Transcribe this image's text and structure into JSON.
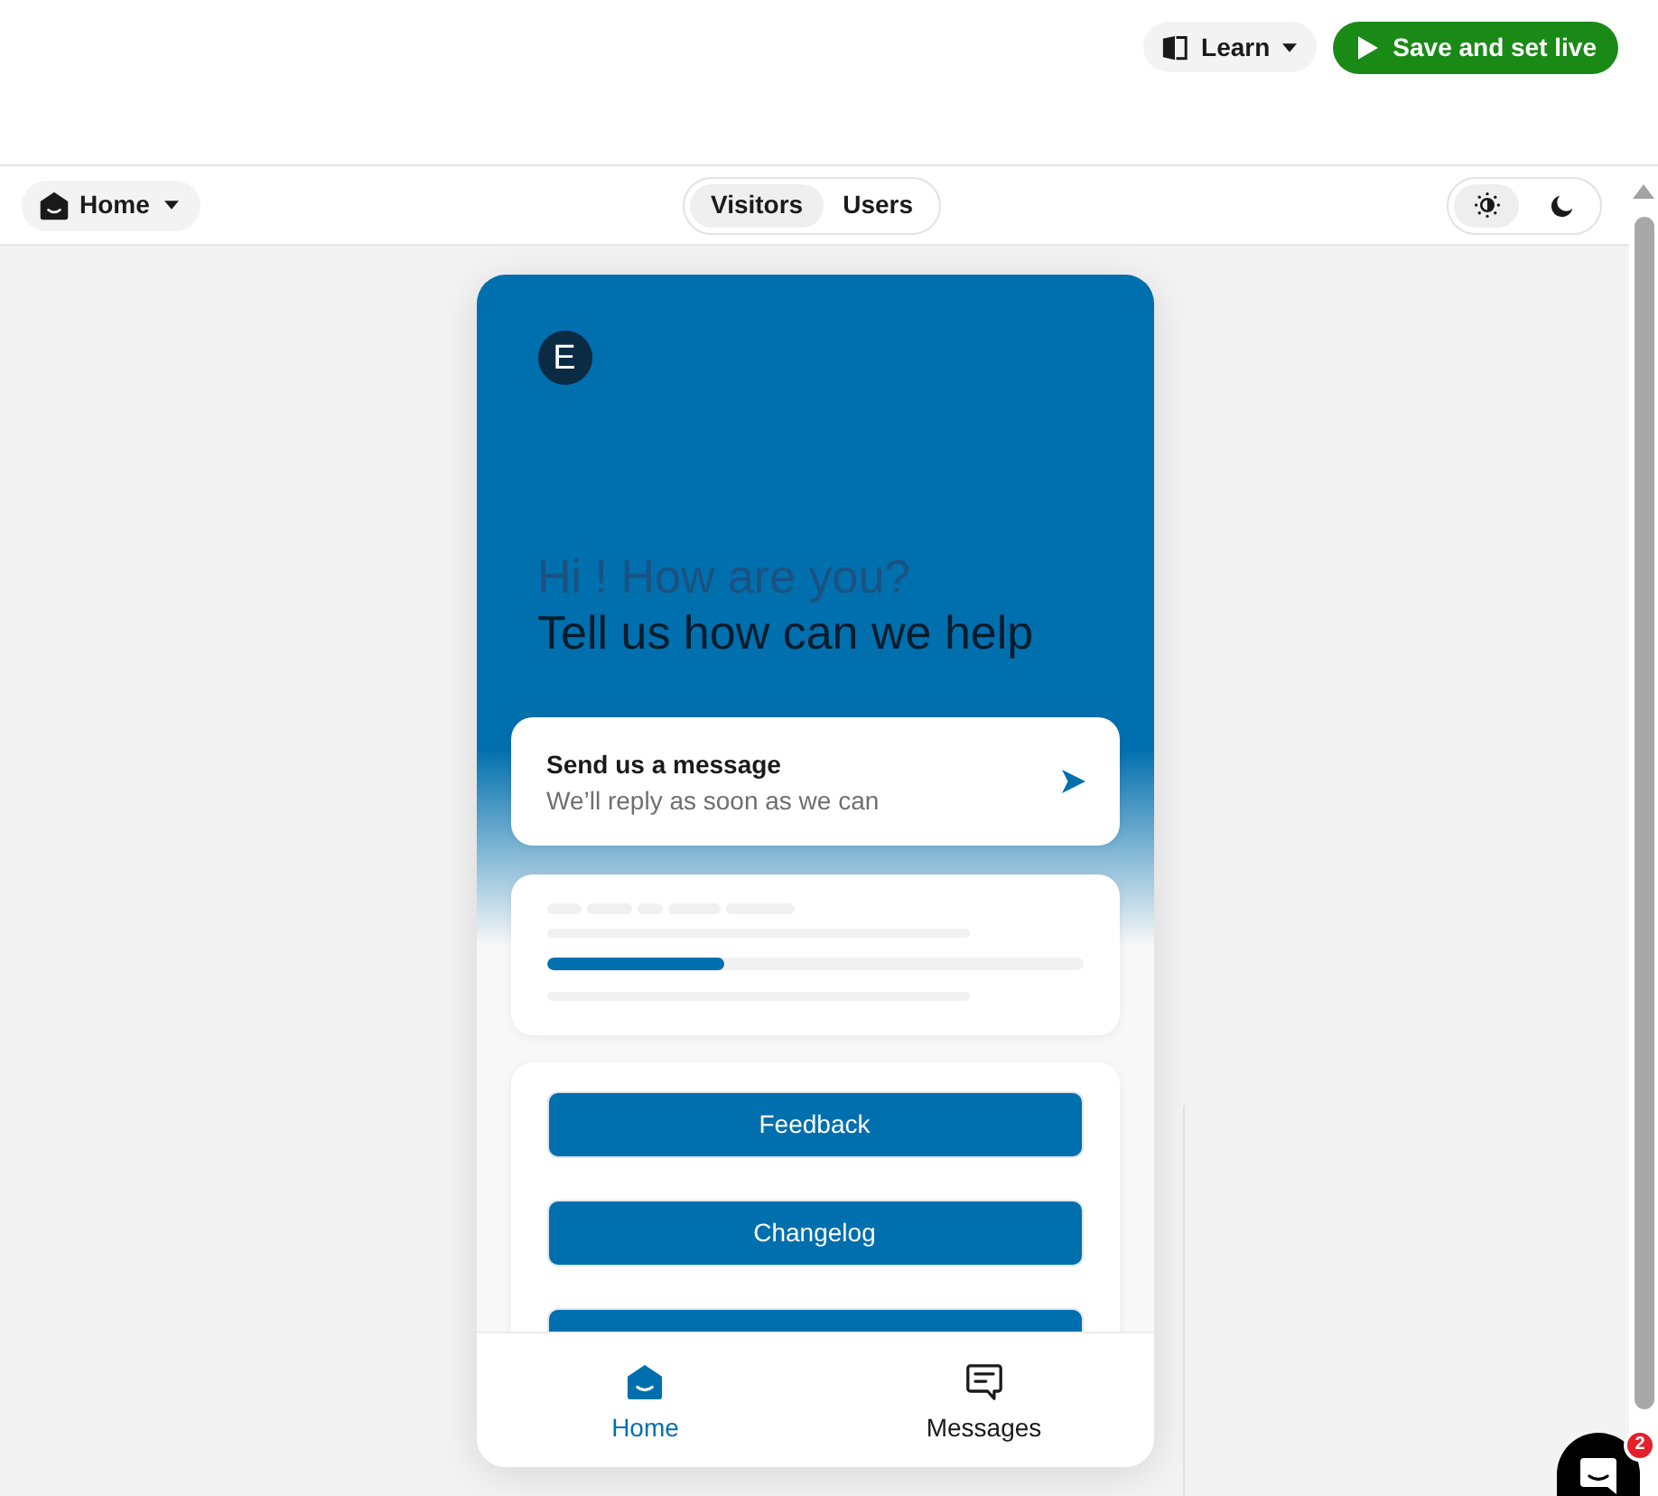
{
  "header": {
    "buttons": [
      {
        "kind": "menu",
        "label": "Learn"
      },
      {
        "kind": "primary",
        "label": "Save and set live"
      }
    ]
  },
  "toolbar": {
    "page_select": {
      "label": "Home"
    },
    "audience_tabs": [
      {
        "label": "Visitors",
        "selected": true
      },
      {
        "label": "Users",
        "selected": false
      }
    ],
    "theme_toggle": [
      {
        "kind": "light",
        "selected": true
      },
      {
        "kind": "dark",
        "selected": false
      }
    ]
  },
  "widget": {
    "logo": {
      "letter": "E"
    },
    "greeting": "Hi ! How are you?",
    "headline": "Tell us how can we help",
    "message_card": {
      "title": "Send us a message",
      "subtitle": "We’ll reply as soon as we can"
    },
    "progress_card": {
      "level": 0.33
    },
    "link_buttons": [
      {
        "kind": "full",
        "label": "Feedback"
      },
      {
        "kind": "full",
        "label": "Changelog"
      },
      {
        "kind": "partial"
      }
    ],
    "nav": [
      {
        "label": "Home",
        "selected": true
      },
      {
        "label": "Messages",
        "selected": false
      }
    ]
  },
  "launcher": {
    "badge": "2"
  }
}
